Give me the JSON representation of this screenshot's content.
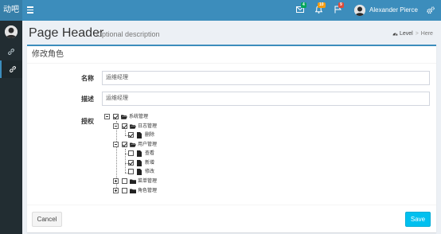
{
  "app": {
    "logo_text": "动吧"
  },
  "topbar": {
    "mail_badge": "4",
    "notif_badge": "10",
    "flag_badge": "9",
    "user_name": "Alexander Pierce",
    "colors": {
      "bar": "#3c8dbc",
      "mail_badge": "#00a65a",
      "notif_badge": "#f39c12",
      "flag_badge": "#dd4b39"
    }
  },
  "header": {
    "title": "Page Header",
    "description": "Optional description",
    "breadcrumb": {
      "level": "Level",
      "current": "Here"
    }
  },
  "form": {
    "title": "修改角色",
    "name_label": "名称",
    "name_value": "运维经理",
    "desc_label": "描述",
    "desc_value": "运维经理",
    "auth_label": "授权"
  },
  "tree": {
    "root": {
      "label": "系统管理",
      "checked": true
    },
    "log": {
      "label": "日志管理",
      "checked": true
    },
    "log_delete": {
      "label": "删除",
      "checked": true
    },
    "user": {
      "label": "用户管理",
      "checked": true
    },
    "user_view": {
      "label": "查看",
      "checked": false
    },
    "user_add": {
      "label": "新增",
      "checked": true
    },
    "user_edit": {
      "label": "修改",
      "checked": false
    },
    "menu": {
      "label": "菜单管理",
      "checked": false
    },
    "role": {
      "label": "角色管理",
      "checked": false
    }
  },
  "footer": {
    "cancel_label": "Cancel",
    "save_label": "Save"
  }
}
